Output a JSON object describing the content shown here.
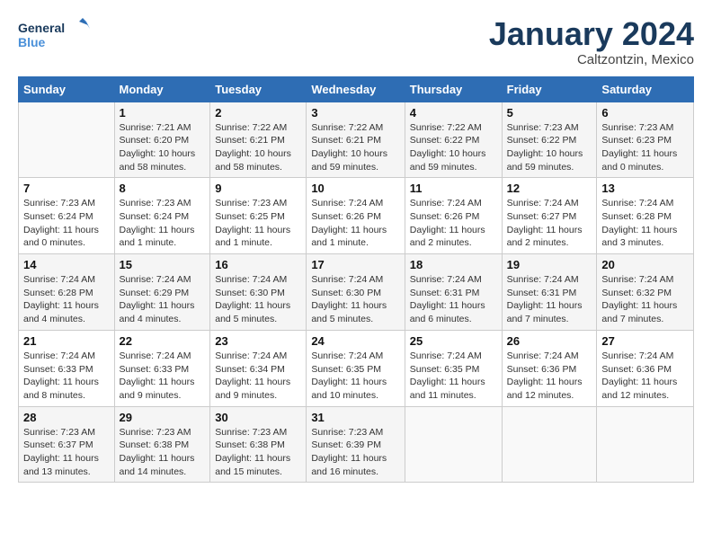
{
  "header": {
    "logo_line1": "General",
    "logo_line2": "Blue",
    "month": "January 2024",
    "location": "Caltzontzin, Mexico"
  },
  "weekdays": [
    "Sunday",
    "Monday",
    "Tuesday",
    "Wednesday",
    "Thursday",
    "Friday",
    "Saturday"
  ],
  "weeks": [
    [
      {
        "num": "",
        "info": ""
      },
      {
        "num": "1",
        "info": "Sunrise: 7:21 AM\nSunset: 6:20 PM\nDaylight: 10 hours\nand 58 minutes."
      },
      {
        "num": "2",
        "info": "Sunrise: 7:22 AM\nSunset: 6:21 PM\nDaylight: 10 hours\nand 58 minutes."
      },
      {
        "num": "3",
        "info": "Sunrise: 7:22 AM\nSunset: 6:21 PM\nDaylight: 10 hours\nand 59 minutes."
      },
      {
        "num": "4",
        "info": "Sunrise: 7:22 AM\nSunset: 6:22 PM\nDaylight: 10 hours\nand 59 minutes."
      },
      {
        "num": "5",
        "info": "Sunrise: 7:23 AM\nSunset: 6:22 PM\nDaylight: 10 hours\nand 59 minutes."
      },
      {
        "num": "6",
        "info": "Sunrise: 7:23 AM\nSunset: 6:23 PM\nDaylight: 11 hours\nand 0 minutes."
      }
    ],
    [
      {
        "num": "7",
        "info": "Sunrise: 7:23 AM\nSunset: 6:24 PM\nDaylight: 11 hours\nand 0 minutes."
      },
      {
        "num": "8",
        "info": "Sunrise: 7:23 AM\nSunset: 6:24 PM\nDaylight: 11 hours\nand 1 minute."
      },
      {
        "num": "9",
        "info": "Sunrise: 7:23 AM\nSunset: 6:25 PM\nDaylight: 11 hours\nand 1 minute."
      },
      {
        "num": "10",
        "info": "Sunrise: 7:24 AM\nSunset: 6:26 PM\nDaylight: 11 hours\nand 1 minute."
      },
      {
        "num": "11",
        "info": "Sunrise: 7:24 AM\nSunset: 6:26 PM\nDaylight: 11 hours\nand 2 minutes."
      },
      {
        "num": "12",
        "info": "Sunrise: 7:24 AM\nSunset: 6:27 PM\nDaylight: 11 hours\nand 2 minutes."
      },
      {
        "num": "13",
        "info": "Sunrise: 7:24 AM\nSunset: 6:28 PM\nDaylight: 11 hours\nand 3 minutes."
      }
    ],
    [
      {
        "num": "14",
        "info": "Sunrise: 7:24 AM\nSunset: 6:28 PM\nDaylight: 11 hours\nand 4 minutes."
      },
      {
        "num": "15",
        "info": "Sunrise: 7:24 AM\nSunset: 6:29 PM\nDaylight: 11 hours\nand 4 minutes."
      },
      {
        "num": "16",
        "info": "Sunrise: 7:24 AM\nSunset: 6:30 PM\nDaylight: 11 hours\nand 5 minutes."
      },
      {
        "num": "17",
        "info": "Sunrise: 7:24 AM\nSunset: 6:30 PM\nDaylight: 11 hours\nand 5 minutes."
      },
      {
        "num": "18",
        "info": "Sunrise: 7:24 AM\nSunset: 6:31 PM\nDaylight: 11 hours\nand 6 minutes."
      },
      {
        "num": "19",
        "info": "Sunrise: 7:24 AM\nSunset: 6:31 PM\nDaylight: 11 hours\nand 7 minutes."
      },
      {
        "num": "20",
        "info": "Sunrise: 7:24 AM\nSunset: 6:32 PM\nDaylight: 11 hours\nand 7 minutes."
      }
    ],
    [
      {
        "num": "21",
        "info": "Sunrise: 7:24 AM\nSunset: 6:33 PM\nDaylight: 11 hours\nand 8 minutes."
      },
      {
        "num": "22",
        "info": "Sunrise: 7:24 AM\nSunset: 6:33 PM\nDaylight: 11 hours\nand 9 minutes."
      },
      {
        "num": "23",
        "info": "Sunrise: 7:24 AM\nSunset: 6:34 PM\nDaylight: 11 hours\nand 9 minutes."
      },
      {
        "num": "24",
        "info": "Sunrise: 7:24 AM\nSunset: 6:35 PM\nDaylight: 11 hours\nand 10 minutes."
      },
      {
        "num": "25",
        "info": "Sunrise: 7:24 AM\nSunset: 6:35 PM\nDaylight: 11 hours\nand 11 minutes."
      },
      {
        "num": "26",
        "info": "Sunrise: 7:24 AM\nSunset: 6:36 PM\nDaylight: 11 hours\nand 12 minutes."
      },
      {
        "num": "27",
        "info": "Sunrise: 7:24 AM\nSunset: 6:36 PM\nDaylight: 11 hours\nand 12 minutes."
      }
    ],
    [
      {
        "num": "28",
        "info": "Sunrise: 7:23 AM\nSunset: 6:37 PM\nDaylight: 11 hours\nand 13 minutes."
      },
      {
        "num": "29",
        "info": "Sunrise: 7:23 AM\nSunset: 6:38 PM\nDaylight: 11 hours\nand 14 minutes."
      },
      {
        "num": "30",
        "info": "Sunrise: 7:23 AM\nSunset: 6:38 PM\nDaylight: 11 hours\nand 15 minutes."
      },
      {
        "num": "31",
        "info": "Sunrise: 7:23 AM\nSunset: 6:39 PM\nDaylight: 11 hours\nand 16 minutes."
      },
      {
        "num": "",
        "info": ""
      },
      {
        "num": "",
        "info": ""
      },
      {
        "num": "",
        "info": ""
      }
    ]
  ]
}
